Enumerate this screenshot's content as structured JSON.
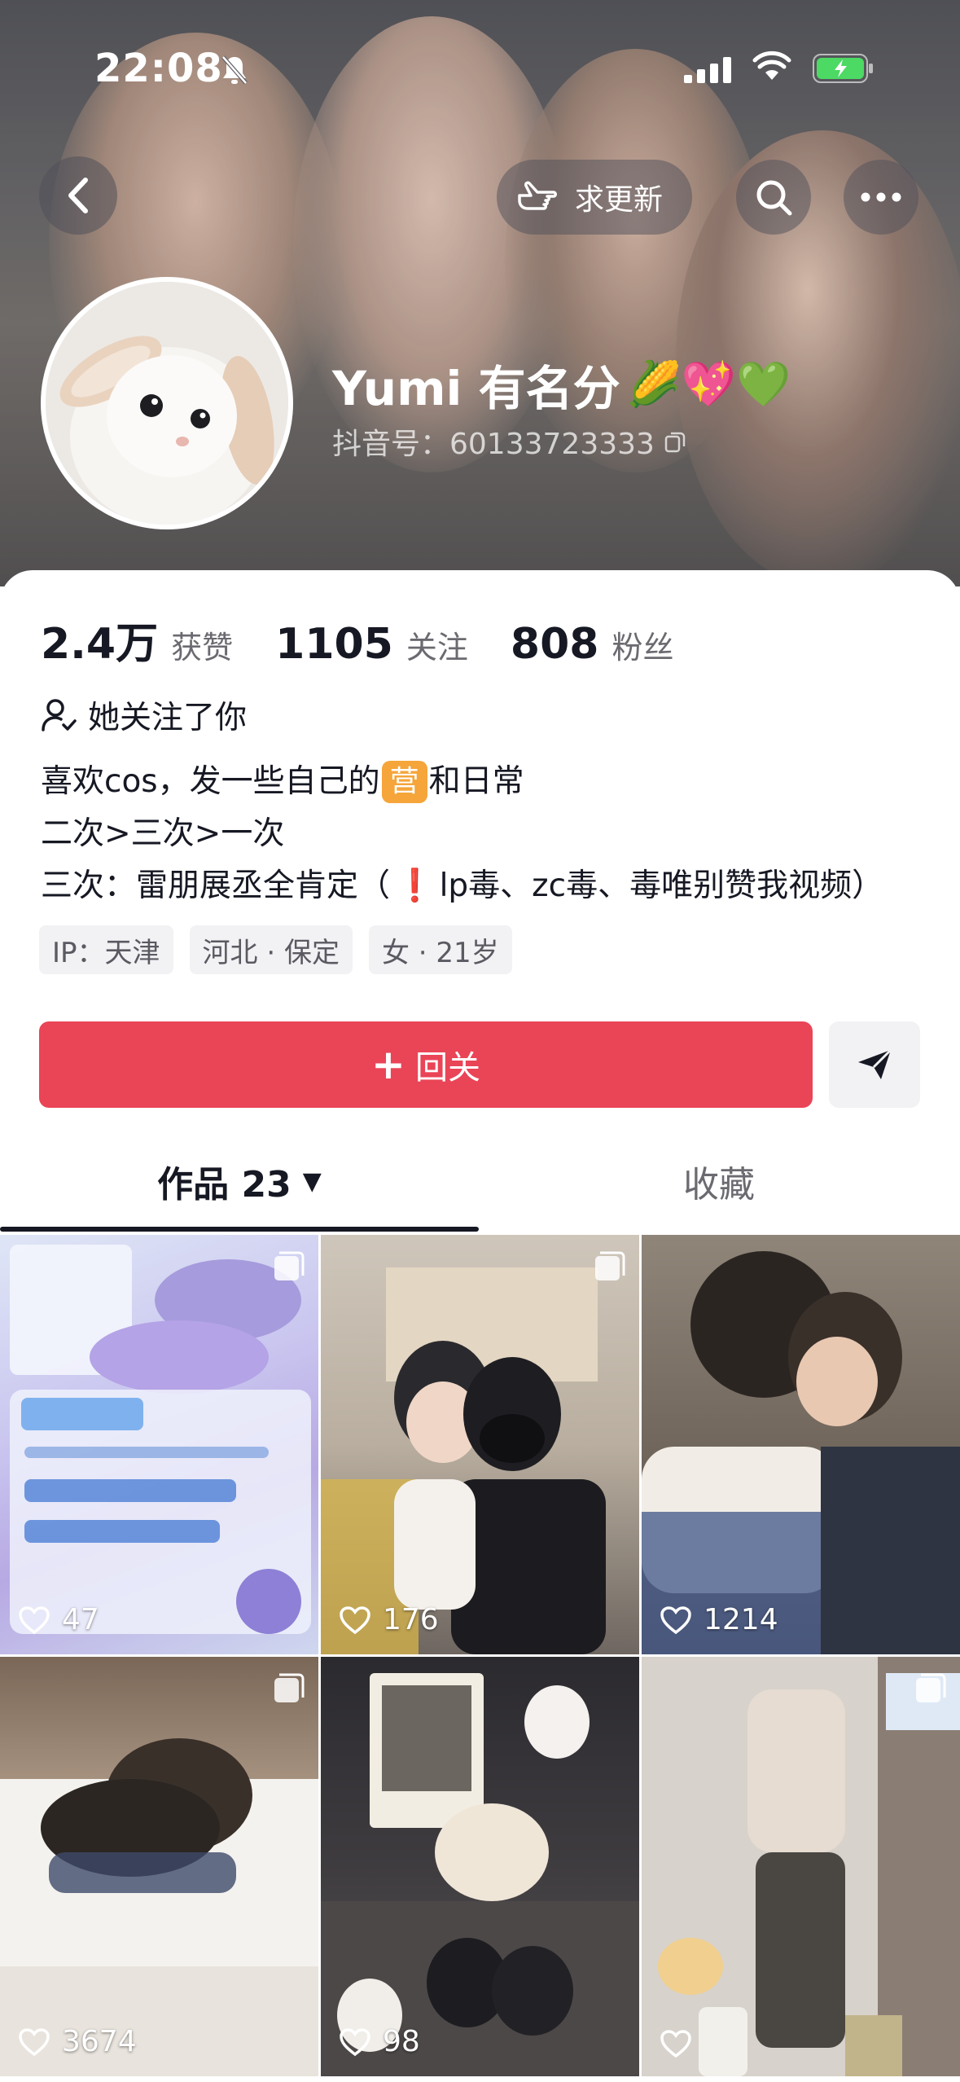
{
  "status_bar": {
    "time": "22:08"
  },
  "header": {
    "update_button_label": "求更新"
  },
  "profile": {
    "name": "Yumi 有名分",
    "name_emojis": "🌽💖💚",
    "douyin_id": "抖音号：60133723333"
  },
  "stats": [
    {
      "value": "2.4万",
      "label": "获赞"
    },
    {
      "value": "1105",
      "label": "关注"
    },
    {
      "value": "808",
      "label": "粉丝"
    }
  ],
  "follow_status": "她关注了你",
  "bio": {
    "line1_a": "喜欢cos，发一些自己的",
    "line1_badge": "营",
    "line1_b": "和日常",
    "line2": "二次>三次>一次",
    "line3_a": "三次：雷朋展丞全肯定（",
    "line3_mark": "❗",
    "line3_b": "lp毒、zc毒、毒唯别赞我视频）"
  },
  "tags": [
    "IP：天津",
    "河北 · 保定",
    "女 · 21岁"
  ],
  "actions": {
    "follow_back_label": "回关"
  },
  "tabs": {
    "works_label": "作品 23",
    "favorites_label": "收藏"
  },
  "grid": [
    {
      "likes": "47"
    },
    {
      "likes": "176"
    },
    {
      "likes": "1214"
    },
    {
      "likes": "3674"
    },
    {
      "likes": "98"
    },
    {
      "likes": ""
    }
  ]
}
